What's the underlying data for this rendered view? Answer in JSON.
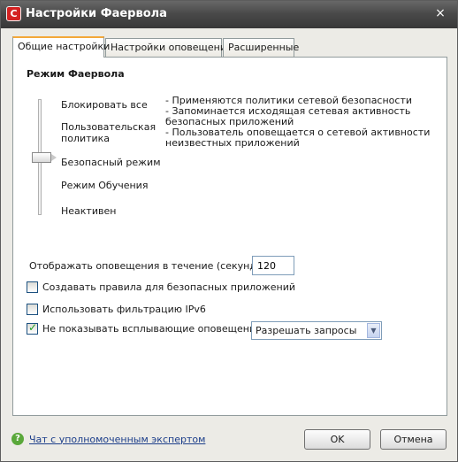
{
  "window": {
    "title": "Настройки Фаервола",
    "app_icon_letter": "C",
    "close_glyph": "×"
  },
  "tabs": [
    {
      "label": "Общие настройки",
      "active": true
    },
    {
      "label": "Настройки оповещений",
      "active": false
    },
    {
      "label": "Расширенные",
      "active": false
    }
  ],
  "mode": {
    "title": "Режим Фаервола",
    "levels": [
      "Блокировать все",
      "Пользовательская политика",
      "Безопасный режим",
      "Режим Обучения",
      "Неактивен"
    ],
    "selected_level": "Безопасный режим",
    "description": [
      "- Применяются политики сетевой безопасности",
      "- Запоминается исходящая сетевая активность безопасных приложений",
      "- Пользователь оповещается о сетевой активности неизвестных приложений"
    ]
  },
  "notifications": {
    "duration_label": "Отображать оповещения в течение (секунд):",
    "duration_value": "120"
  },
  "options": [
    {
      "label": "Создавать правила для безопасных приложений",
      "checked": false
    },
    {
      "label": "Использовать фильтрацию IPv6",
      "checked": false
    },
    {
      "label": "Не показывать всплывающие оповещения",
      "checked": true
    }
  ],
  "popup_action": {
    "selected": "Разрешать запросы",
    "arrow_glyph": "▼"
  },
  "footer": {
    "help_icon_glyph": "?",
    "help_link": "Чат с уполномоченным экспертом",
    "ok_label": "OK",
    "cancel_label": "Отмена"
  }
}
